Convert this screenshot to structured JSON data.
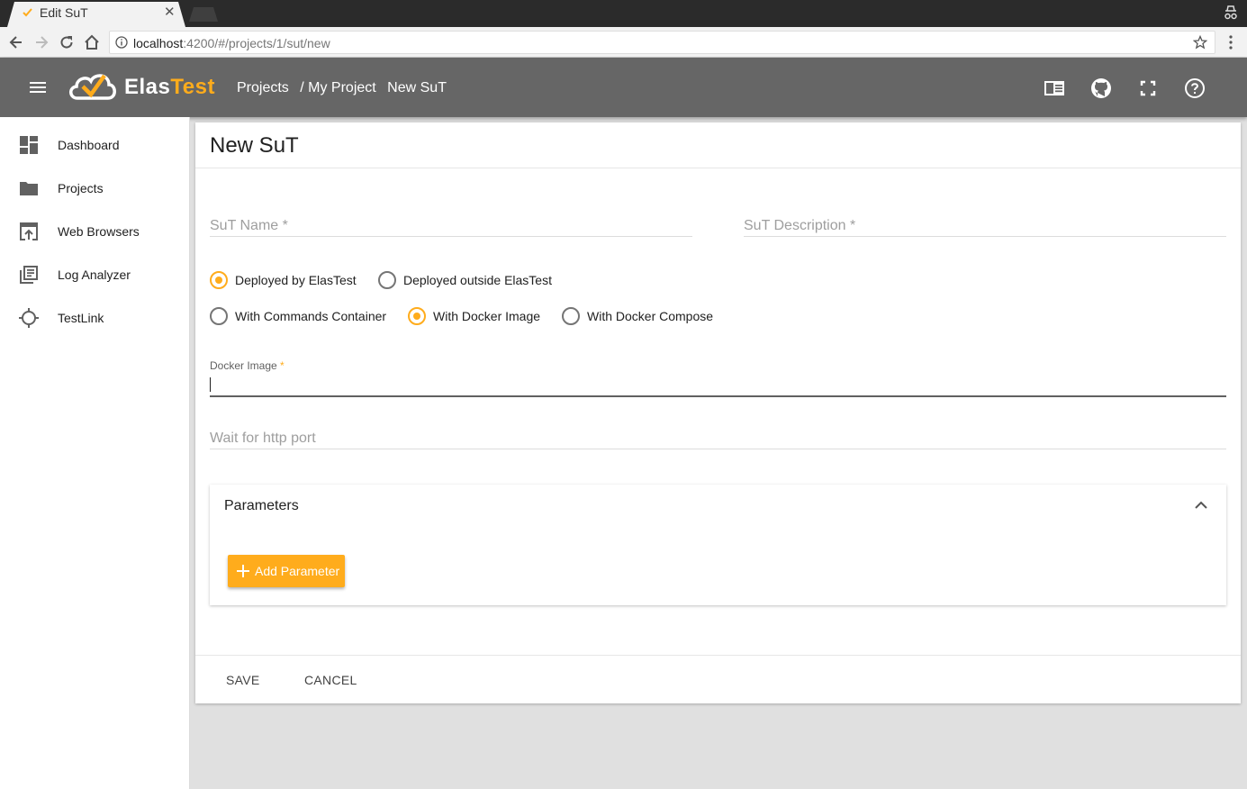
{
  "browser": {
    "tab_title": "Edit SuT",
    "url_host": "localhost",
    "url_path": ":4200/#/projects/1/sut/new"
  },
  "header": {
    "logo_elas": "Elas",
    "logo_test": "Test",
    "breadcrumb": [
      "Projects",
      "/ My Project",
      "New SuT"
    ]
  },
  "sidebar": {
    "items": [
      {
        "label": "Dashboard",
        "icon": "dashboard-icon"
      },
      {
        "label": "Projects",
        "icon": "folder-icon"
      },
      {
        "label": "Web Browsers",
        "icon": "open-in-browser-icon"
      },
      {
        "label": "Log Analyzer",
        "icon": "library-books-icon"
      },
      {
        "label": "TestLink",
        "icon": "gps-crosshair-icon"
      }
    ]
  },
  "form": {
    "title": "New SuT",
    "sut_name_placeholder": "SuT Name *",
    "sut_description_placeholder": "SuT Description *",
    "deploy_options": [
      {
        "label": "Deployed by ElasTest",
        "checked": true
      },
      {
        "label": "Deployed outside ElasTest",
        "checked": false
      }
    ],
    "mode_options": [
      {
        "label": "With Commands Container",
        "checked": false
      },
      {
        "label": "With Docker Image",
        "checked": true
      },
      {
        "label": "With Docker Compose",
        "checked": false
      }
    ],
    "docker_image_label": "Docker Image",
    "docker_image_required": "*",
    "docker_image_value": "",
    "wait_port_placeholder": "Wait for http port",
    "parameters_title": "Parameters",
    "add_parameter_label": "Add Parameter",
    "save_label": "SAVE",
    "cancel_label": "CANCEL"
  },
  "colors": {
    "accent": "#ffac1c",
    "header_bg": "#666666",
    "page_bg": "#e0e0e0"
  }
}
